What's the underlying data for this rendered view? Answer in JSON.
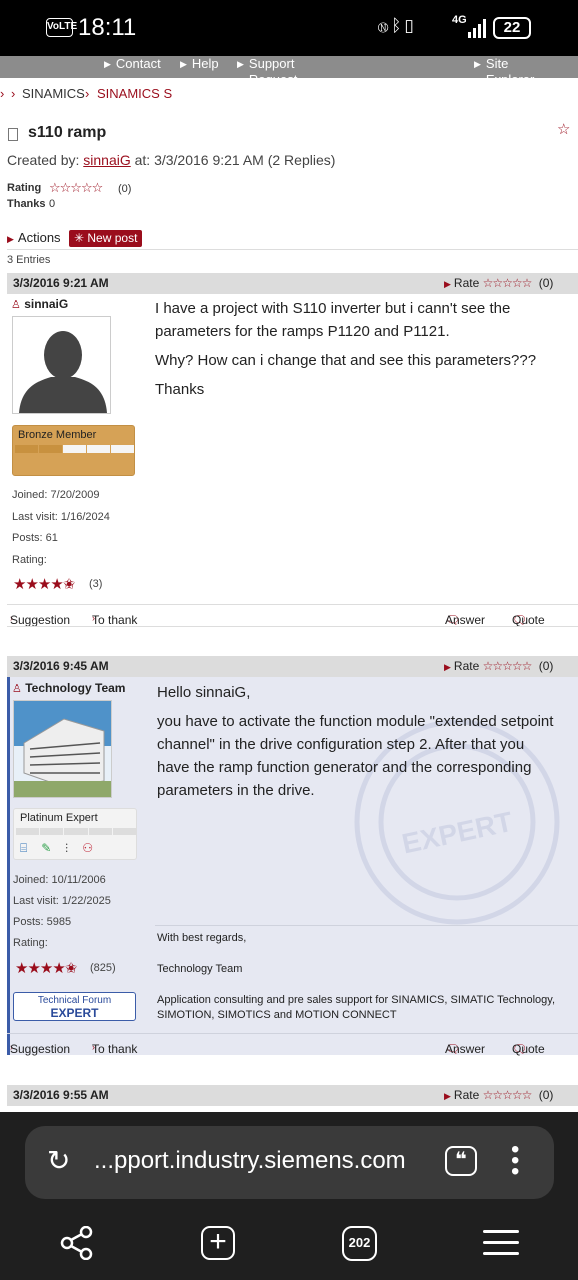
{
  "status_bar": {
    "volte": "VoLTE",
    "time": "18:11",
    "network": "4G",
    "battery": "22"
  },
  "top_nav": [
    "Contact",
    "Help",
    "Support Request",
    "Site Explorer"
  ],
  "breadcrumb": [
    "SINAMICS",
    "SINAMICS S"
  ],
  "topic": {
    "title": "s110 ramp",
    "created_prefix": "Created by:",
    "author": "sinnaiG",
    "created_suffix": "at: 3/3/2016 9:21 AM (2 Replies)",
    "rating_label": "Rating",
    "rating_count": "(0)",
    "thanks_label": "Thanks",
    "thanks_count": "0"
  },
  "actions": {
    "actions_label": "Actions",
    "new_post_label": "New post",
    "entries": "3 Entries"
  },
  "posts": [
    {
      "date": "3/3/2016 9:21 AM",
      "rate_label": "Rate",
      "rate_count": "(0)",
      "author": "sinnaiG",
      "rank": "Bronze Member",
      "joined": "Joined: 7/20/2009",
      "last_visit": "Last visit: 1/16/2024",
      "posts": "Posts: 61",
      "rating_label": "Rating:",
      "rating_count": "(3)",
      "paragraphs": [
        "I have a project with S110 inverter but i cann't see the parameters for the ramps P1120 and P1121.",
        "Why? How can i change that and see this parameters???",
        "Thanks"
      ],
      "footer": {
        "suggestion": "Suggestion",
        "thank": "To thank",
        "answer": "Answer",
        "quote": "Quote"
      }
    },
    {
      "date": "3/3/2016 9:45 AM",
      "rate_label": "Rate",
      "rate_count": "(0)",
      "author": "Technology Team",
      "rank": "Platinum Expert",
      "joined": "Joined: 10/11/2006",
      "last_visit": "Last visit: 1/22/2025",
      "posts": "Posts: 5985",
      "rating_label": "Rating:",
      "rating_count": "(825)",
      "badge_line1": "Technical Forum",
      "badge_line2": "EXPERT",
      "paragraphs": [
        "Hello sinnaiG,",
        "you have to activate the function module \"extended setpoint channel\" in the drive configuration step 2. After that you have the ramp function generator and the corresponding parameters in the drive."
      ],
      "signature": [
        "With best regards,",
        "Technology Team",
        "Application consulting and pre sales support for SINAMICS, SIMATIC Technology, SIMOTION, SIMOTICS and MOTION CONNECT"
      ],
      "footer": {
        "suggestion": "Suggestion",
        "thank": "To thank",
        "answer": "Answer",
        "quote": "Quote"
      }
    },
    {
      "date": "3/3/2016 9:55 AM",
      "rate_label": "Rate",
      "rate_count": "(0)"
    }
  ],
  "browser": {
    "url": "...pport.industry.siemens.com",
    "tab_count": "202"
  }
}
